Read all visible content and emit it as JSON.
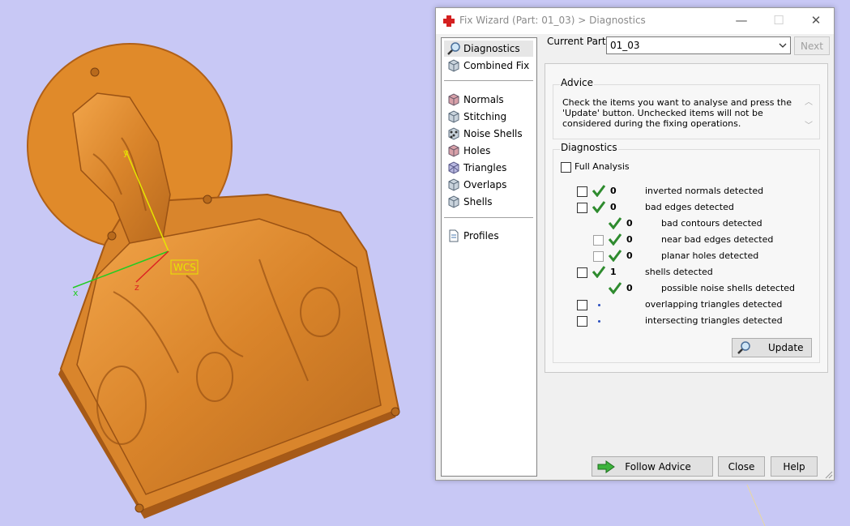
{
  "viewport": {
    "wcs_label": "WCS",
    "axis_x": "x",
    "axis_y": "y",
    "axis_z": "z"
  },
  "window": {
    "title": "Fix Wizard (Part: 01_03) > Diagnostics",
    "minimize_glyph": "—",
    "maximize_glyph": "☐",
    "close_glyph": "✕"
  },
  "sidebar": {
    "top_items": [
      {
        "label": "Diagnostics",
        "icon": "magnifier-icon",
        "active": true
      },
      {
        "label": "Combined Fix",
        "icon": "cube-icon"
      }
    ],
    "fix_items": [
      {
        "label": "Normals",
        "icon": "normals-cube-icon"
      },
      {
        "label": "Stitching",
        "icon": "stitching-cube-icon"
      },
      {
        "label": "Noise Shells",
        "icon": "noise-shells-icon"
      },
      {
        "label": "Holes",
        "icon": "holes-cube-icon"
      },
      {
        "label": "Triangles",
        "icon": "triangles-cube-icon"
      },
      {
        "label": "Overlaps",
        "icon": "overlaps-cube-icon"
      },
      {
        "label": "Shells",
        "icon": "shells-cube-icon"
      }
    ],
    "bottom_items": [
      {
        "label": "Profiles",
        "icon": "document-icon"
      }
    ]
  },
  "header": {
    "current_part_label": "Current Part:",
    "current_part_value": "01_03",
    "next_label": "Next"
  },
  "advice": {
    "title": "Advice",
    "text": "Check the items you want to analyse and press the 'Update' button. Unchecked items will not be considered during the fixing operations."
  },
  "diagnostics": {
    "title": "Diagnostics",
    "full_analysis_label": "Full Analysis",
    "rows": [
      {
        "count": "0",
        "label": "inverted normals detected",
        "status": "ok"
      },
      {
        "count": "0",
        "label": "bad edges detected",
        "status": "ok"
      },
      {
        "count": "0",
        "label": "bad contours detected",
        "status": "ok"
      },
      {
        "count": "0",
        "label": "near bad edges detected",
        "status": "ok"
      },
      {
        "count": "0",
        "label": "planar holes detected",
        "status": "ok"
      },
      {
        "count": "1",
        "label": "shells detected",
        "status": "ok"
      },
      {
        "count": "0",
        "label": "possible noise shells detected",
        "status": "ok"
      },
      {
        "count": "",
        "label": "overlapping triangles detected",
        "status": "not-run"
      },
      {
        "count": "",
        "label": "intersecting triangles detected",
        "status": "not-run"
      }
    ],
    "update_label": "Update"
  },
  "footer": {
    "follow_advice_label": "Follow Advice",
    "close_label": "Close",
    "help_label": "Help"
  },
  "colors": {
    "model": "#e08a2a",
    "background": "#c8c8f5",
    "check_green": "#2e8b2e"
  }
}
